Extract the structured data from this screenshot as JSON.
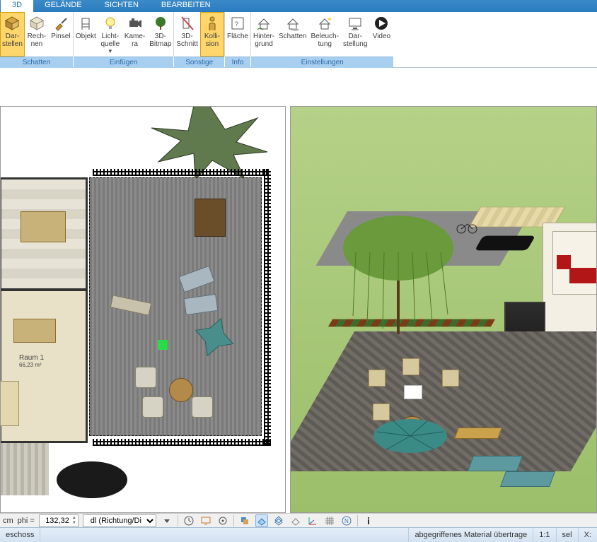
{
  "tabs": {
    "t3d": "3D",
    "gelaende": "GELÄNDE",
    "sichten": "SICHTEN",
    "bearbeiten": "BEARBEITEN"
  },
  "ribbon": {
    "schatten": {
      "label": "Schatten",
      "darstellen": "Dar-\nstellen",
      "rechnen": "Rech-\nnen",
      "pinsel": "Pinsel"
    },
    "einfuegen": {
      "label": "Einfügen",
      "objekt": "Objekt",
      "licht": "Licht-\nquelle",
      "kamera": "Kame-\nra",
      "bitmap": "3D-\nBitmap"
    },
    "sonstige": {
      "label": "Sonstige",
      "schnitt": "3D-\nSchnitt",
      "kollision": "Kolli-\nsion"
    },
    "info": {
      "label": "Info",
      "flaeche": "Fläche"
    },
    "einstellungen": {
      "label": "Einstellungen",
      "hintergrund": "Hinter-\ngrund",
      "schatten": "Schatten",
      "beleuchtung": "Beleuch-\ntung",
      "darstellung": "Dar-\nstellung",
      "video": "Video"
    }
  },
  "plan": {
    "room1": "Raum 1",
    "room1area": "66,23 m²"
  },
  "bottombar": {
    "unit": "cm",
    "phi_label": "phi =",
    "phi_value": "132,32",
    "dl_label": "dl (Richtung/Di"
  },
  "status": {
    "left": "eschoss",
    "right1": "abgegriffenes Material übertrage",
    "right2": "1:1",
    "right3": "sel",
    "right4": "X:"
  }
}
